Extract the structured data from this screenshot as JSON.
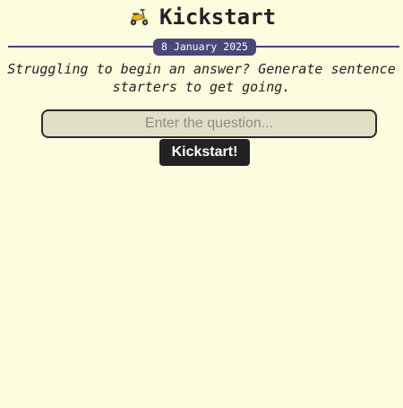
{
  "header": {
    "icon": "motor-scooter-icon",
    "title": "Kickstart"
  },
  "date_badge": {
    "label": "8 January 2025"
  },
  "tagline": "Struggling to begin an answer? Generate sentence starters to get going.",
  "question_input": {
    "value": "",
    "placeholder": "Enter the question..."
  },
  "submit_button": {
    "label": "Kickstart!"
  },
  "colors": {
    "background": "#fcfcdf",
    "accent": "#4a4679",
    "button": "#222222",
    "input_background": "#e0dfc7"
  }
}
